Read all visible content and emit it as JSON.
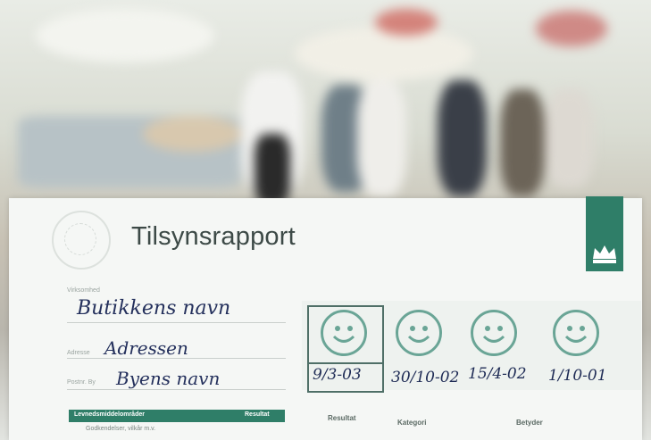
{
  "report": {
    "title": "Tilsynsrapport",
    "field_labels": {
      "virksomhed": "Virksomhed",
      "adresse": "Adresse",
      "postnr_by": "Postnr. By"
    },
    "handwritten": {
      "virksomhed": "Butikkens navn",
      "adresse": "Adressen",
      "postnr_by": "Byens navn"
    },
    "dates": [
      "9/3-03",
      "30/10-02",
      "15/4-02",
      "1/10-01"
    ],
    "table_header": {
      "left": "Levnedsmiddelområder",
      "right": "Resultat"
    },
    "table_row": "Godkendelser, vilkår m.v.",
    "bottom_labels": {
      "resultat": "Resultat",
      "kategori": "Kategori",
      "betyder": "Betyder"
    },
    "colors": {
      "brand_green": "#2f7e68",
      "smiley": "#6aa596",
      "ink": "#24305c"
    },
    "icons": [
      "crown-icon",
      "smiley-icon",
      "emblem-icon"
    ]
  }
}
